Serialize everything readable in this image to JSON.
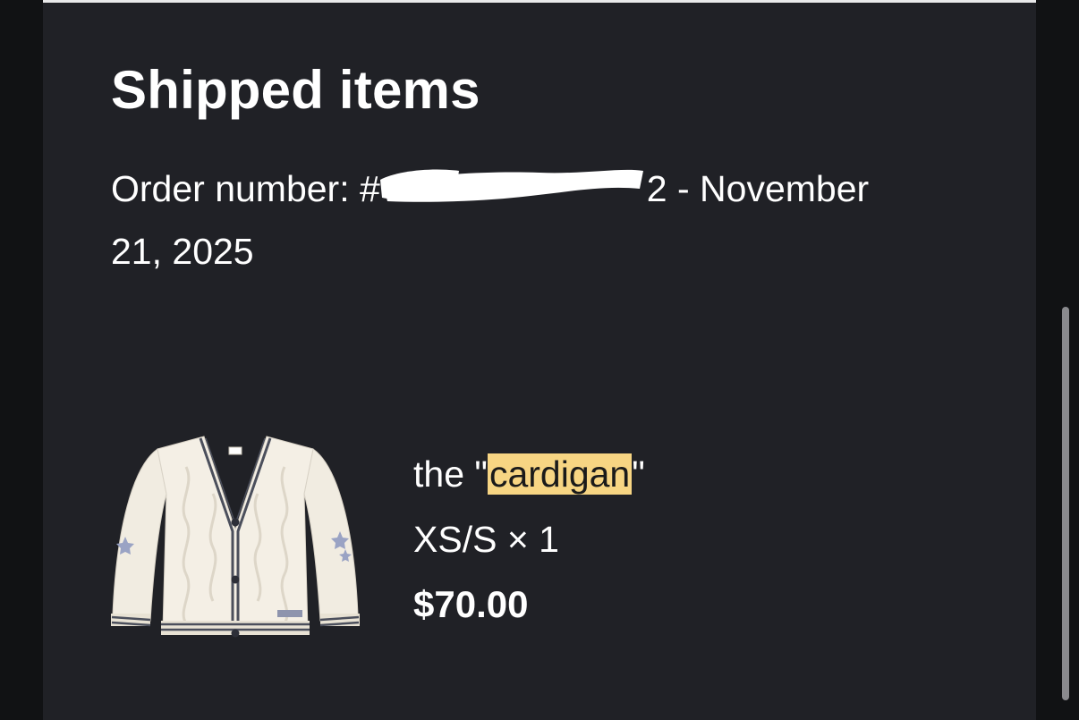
{
  "section": {
    "title": "Shipped items"
  },
  "order": {
    "label": "Order number: #",
    "number_tail": "2",
    "date_separator": " - ",
    "date": "November 21, 2025"
  },
  "item": {
    "image": "cardigan-product-image",
    "name_prefix": "the \"",
    "name_highlight": "cardigan",
    "name_suffix": "\"",
    "variant": "XS/S",
    "quantity_text": " × 1",
    "price": "$70.00"
  },
  "colors": {
    "background": "#202126",
    "highlight": "#f7d583"
  }
}
